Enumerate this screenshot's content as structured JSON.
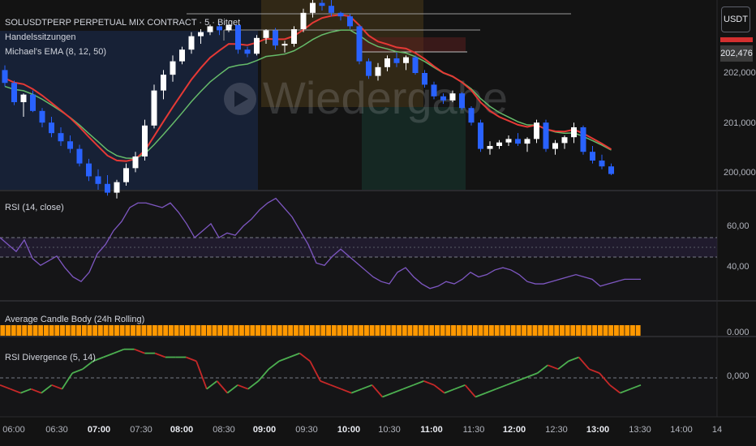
{
  "header": {
    "symbol_line": "SOLUSDTPERP PERPETUAL MIX CONTRACT · 5 · Bitget",
    "indicator_sessions": "Handelssitzungen",
    "indicator_ema": "Michael's EMA (8, 12, 50)"
  },
  "watermark": "Wiedergabe",
  "price_axis": {
    "currency": "USDT",
    "current_price": "202,476",
    "ticks": [
      "202,000",
      "201,000",
      "200,000"
    ]
  },
  "rsi_panel": {
    "title": "RSI (14, close)",
    "ticks": [
      "60,00",
      "40,00"
    ]
  },
  "acb_panel": {
    "title": "Average Candle Body (24h Rolling)",
    "tick": "0.000"
  },
  "div_panel": {
    "title": "RSI Divergence (5, 14)",
    "tick": "0,000"
  },
  "time_axis": {
    "labels": [
      "06:00",
      "06:30",
      "07:00",
      "07:30",
      "08:00",
      "08:30",
      "09:00",
      "09:30",
      "10:00",
      "10:30",
      "11:00",
      "11:30",
      "12:00",
      "12:30",
      "13:00",
      "13:30",
      "14:00",
      "14"
    ],
    "bold": [
      "07:00",
      "08:00",
      "09:00",
      "10:00",
      "11:00",
      "12:00",
      "13:00"
    ]
  },
  "colors": {
    "up": "#ffffff",
    "down": "#2962ff",
    "ema_fast": "#e53935",
    "ema_slow": "#66bb6a",
    "rsi_line": "#7e57c2",
    "acb_bar": "#ff9800",
    "div_up": "#4caf50",
    "div_down": "#c62828"
  },
  "chart_data": [
    {
      "type": "candlestick",
      "name": "price",
      "ylim": [
        199.65,
        202.9
      ],
      "x_start": "05:40",
      "x_step_minutes": 5,
      "ohlc": [
        [
          201.7,
          201.78,
          201.42,
          201.48
        ],
        [
          201.48,
          201.52,
          201.1,
          201.15
        ],
        [
          201.15,
          201.3,
          200.9,
          201.28
        ],
        [
          201.28,
          201.35,
          200.98,
          201.0
        ],
        [
          201.0,
          201.05,
          200.72,
          200.8
        ],
        [
          200.8,
          200.9,
          200.55,
          200.62
        ],
        [
          200.62,
          200.72,
          200.4,
          200.48
        ],
        [
          200.48,
          200.58,
          200.28,
          200.35
        ],
        [
          200.35,
          200.42,
          200.05,
          200.1
        ],
        [
          200.1,
          200.18,
          199.8,
          199.88
        ],
        [
          199.88,
          200.0,
          199.65,
          199.75
        ],
        [
          199.75,
          199.9,
          199.55,
          199.6
        ],
        [
          199.6,
          199.82,
          199.5,
          199.78
        ],
        [
          199.78,
          200.1,
          199.72,
          200.02
        ],
        [
          200.02,
          200.3,
          199.95,
          200.22
        ],
        [
          200.22,
          200.85,
          200.15,
          200.75
        ],
        [
          200.75,
          201.45,
          200.7,
          201.35
        ],
        [
          201.35,
          201.7,
          201.2,
          201.62
        ],
        [
          201.62,
          201.95,
          201.5,
          201.85
        ],
        [
          201.85,
          202.1,
          201.8,
          202.05
        ],
        [
          202.05,
          202.35,
          201.98,
          202.28
        ],
        [
          202.28,
          202.4,
          202.15,
          202.35
        ],
        [
          202.35,
          202.48,
          202.3,
          202.45
        ],
        [
          202.45,
          202.5,
          202.3,
          202.38
        ],
        [
          202.38,
          202.52,
          202.35,
          202.47
        ],
        [
          202.47,
          202.48,
          201.98,
          202.05
        ],
        [
          202.05,
          202.1,
          201.92,
          201.98
        ],
        [
          201.98,
          202.3,
          201.95,
          202.25
        ],
        [
          202.25,
          202.4,
          202.15,
          202.38
        ],
        [
          202.38,
          202.42,
          202.05,
          202.12
        ],
        [
          202.12,
          202.2,
          202.0,
          202.15
        ],
        [
          202.15,
          202.45,
          202.1,
          202.4
        ],
        [
          202.4,
          202.75,
          202.35,
          202.68
        ],
        [
          202.68,
          202.9,
          202.6,
          202.85
        ],
        [
          202.85,
          202.95,
          202.72,
          202.8
        ],
        [
          202.8,
          202.9,
          202.62,
          202.68
        ],
        [
          202.68,
          202.7,
          202.55,
          202.62
        ],
        [
          202.62,
          202.66,
          202.4,
          202.45
        ],
        [
          202.45,
          202.48,
          201.8,
          201.85
        ],
        [
          201.85,
          201.9,
          201.55,
          201.6
        ],
        [
          201.6,
          201.82,
          201.52,
          201.75
        ],
        [
          201.75,
          201.95,
          201.68,
          201.9
        ],
        [
          201.9,
          202.0,
          201.75,
          201.82
        ],
        [
          201.82,
          201.95,
          201.7,
          201.92
        ],
        [
          201.92,
          201.95,
          201.62,
          201.65
        ],
        [
          201.65,
          201.7,
          201.4,
          201.45
        ],
        [
          201.45,
          201.5,
          201.2,
          201.25
        ],
        [
          201.25,
          201.3,
          201.12,
          201.18
        ],
        [
          201.18,
          201.35,
          201.15,
          201.3
        ],
        [
          201.3,
          201.32,
          201.02,
          201.05
        ],
        [
          201.05,
          201.08,
          200.75,
          200.8
        ],
        [
          200.8,
          200.85,
          200.3,
          200.35
        ],
        [
          200.35,
          200.48,
          200.25,
          200.4
        ],
        [
          200.4,
          200.5,
          200.35,
          200.46
        ],
        [
          200.46,
          200.58,
          200.4,
          200.52
        ],
        [
          200.52,
          200.62,
          200.4,
          200.44
        ],
        [
          200.44,
          200.55,
          200.3,
          200.52
        ],
        [
          200.52,
          200.85,
          200.45,
          200.8
        ],
        [
          200.8,
          200.85,
          200.3,
          200.35
        ],
        [
          200.35,
          200.5,
          200.25,
          200.45
        ],
        [
          200.45,
          200.58,
          200.35,
          200.55
        ],
        [
          200.55,
          200.8,
          200.45,
          200.72
        ],
        [
          200.72,
          200.75,
          200.25,
          200.3
        ],
        [
          200.3,
          200.4,
          200.1,
          200.15
        ],
        [
          200.15,
          200.25,
          200.0,
          200.05
        ],
        [
          200.05,
          200.1,
          199.9,
          199.92
        ]
      ]
    },
    {
      "type": "line",
      "name": "RSI (14, close)",
      "ylim": [
        28,
        75
      ],
      "guide_lines": [
        54,
        50,
        46
      ],
      "values": [
        55,
        52,
        49,
        54,
        46,
        43,
        45,
        47,
        42,
        38,
        36,
        40,
        48,
        52,
        58,
        62,
        68,
        70,
        70,
        69,
        68,
        70,
        66,
        61,
        55,
        58,
        61,
        55,
        57,
        56,
        60,
        63,
        67,
        70,
        72,
        68,
        64,
        58,
        52,
        44,
        43,
        47,
        50,
        47,
        44,
        41,
        38,
        36,
        35,
        40,
        42,
        38,
        35,
        33,
        34,
        36,
        35,
        37,
        40,
        38,
        39,
        41,
        42,
        41,
        39,
        36,
        35,
        35,
        36,
        37,
        38,
        39,
        38,
        37,
        34,
        35,
        36,
        37,
        37,
        37
      ]
    },
    {
      "type": "bar",
      "name": "Average Candle Body (24h Rolling)",
      "ylim": [
        0,
        1
      ],
      "values_note_none": "",
      "count": 118
    },
    {
      "type": "line",
      "name": "RSI Divergence (5, 14)",
      "ylim": [
        -10,
        10
      ],
      "values": [
        -2,
        -3,
        -4,
        -3,
        -4,
        -2,
        -3,
        1,
        2,
        4,
        5,
        6,
        7,
        7,
        6,
        6,
        5,
        5,
        5,
        4,
        -3,
        -1,
        -4,
        -2,
        -3,
        -1,
        2,
        4,
        5,
        6,
        4,
        -1,
        -2,
        -3,
        -4,
        -3,
        -2,
        -5,
        -4,
        -3,
        -2,
        -1,
        -2,
        -4,
        -3,
        -2,
        -5,
        -4,
        -3,
        -2,
        -1,
        0,
        1,
        3,
        2,
        4,
        5,
        2,
        1,
        -2,
        -4,
        -3,
        -2
      ]
    }
  ]
}
